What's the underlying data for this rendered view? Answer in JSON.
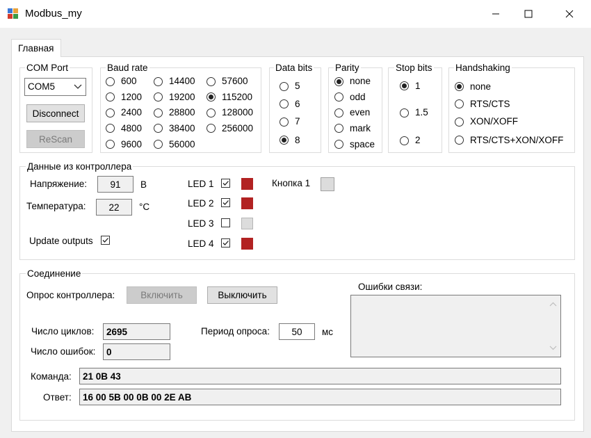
{
  "window": {
    "title": "Modbus_my"
  },
  "tabs": [
    "Главная"
  ],
  "com_port": {
    "title": "COM Port",
    "selected": "COM5",
    "disconnect": "Disconnect",
    "rescan": "ReScan"
  },
  "baud": {
    "title": "Baud rate",
    "options": [
      "600",
      "1200",
      "2400",
      "4800",
      "9600",
      "14400",
      "19200",
      "28800",
      "38400",
      "56000",
      "57600",
      "115200",
      "128000",
      "256000"
    ],
    "selected": "115200"
  },
  "data_bits": {
    "title": "Data bits",
    "options": [
      "5",
      "6",
      "7",
      "8"
    ],
    "selected": "8"
  },
  "parity": {
    "title": "Parity",
    "options": [
      "none",
      "odd",
      "even",
      "mark",
      "space"
    ],
    "selected": "none"
  },
  "stop_bits": {
    "title": "Stop bits",
    "options": [
      "1",
      "1.5",
      "2"
    ],
    "selected": "1"
  },
  "handshaking": {
    "title": "Handshaking",
    "options": [
      "none",
      "RTS/CTS",
      "XON/XOFF",
      "RTS/CTS+XON/XOFF"
    ],
    "selected": "none"
  },
  "controller": {
    "title": "Данные из контроллера",
    "voltage_label": "Напряжение:",
    "voltage": "91",
    "voltage_unit": "B",
    "temp_label": "Температура:",
    "temp": "22",
    "temp_unit": "°C",
    "update_label": "Update outputs",
    "update_checked": true,
    "leds": [
      {
        "label": "LED 1",
        "checked": true,
        "color": "#b22222"
      },
      {
        "label": "LED 2",
        "checked": true,
        "color": "#b22222"
      },
      {
        "label": "LED 3",
        "checked": false,
        "color": "#dcdcdc"
      },
      {
        "label": "LED 4",
        "checked": true,
        "color": "#b22222"
      }
    ],
    "button_label": "Кнопка 1",
    "button_color": "#dcdcdc"
  },
  "connection": {
    "title": "Соединение",
    "poll_label": "Опрос контроллера:",
    "on_button": "Включить",
    "off_button": "Выключить",
    "errors_label": "Ошибки связи:",
    "cycles_label": "Число циклов:",
    "cycles": "2695",
    "errors_count_label": "Число ошибок:",
    "errors_count": "0",
    "period_label": "Период опроса:",
    "period": "50",
    "period_unit": "мс",
    "command_label": "Команда:",
    "command": "21 0B 43",
    "answer_label": "Ответ:",
    "answer": "16 00 5B 00 0B 00 2E AB"
  }
}
